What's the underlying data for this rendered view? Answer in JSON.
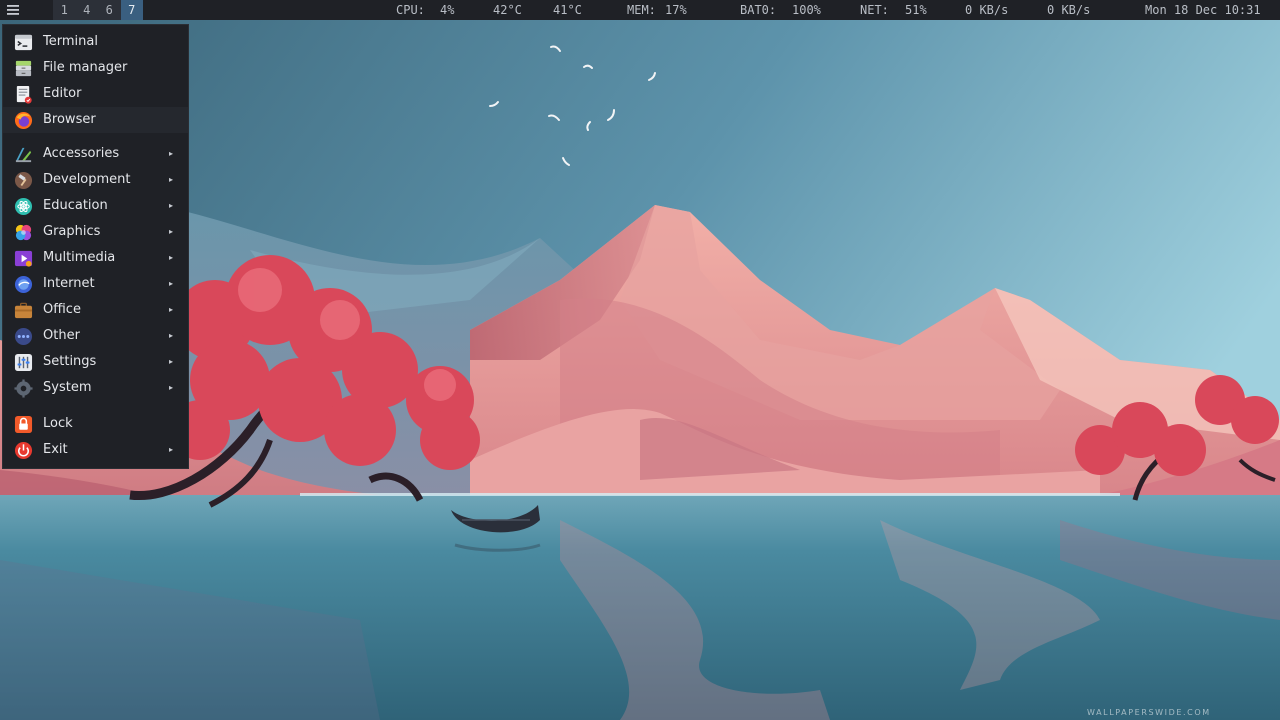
{
  "topbar": {
    "workspaces": [
      "1",
      "4",
      "6",
      "7"
    ],
    "active_workspace": "7",
    "cpu_label": "CPU:",
    "cpu_value": "4%",
    "temp1": "42°C",
    "temp2": "41°C",
    "mem_label": "MEM:",
    "mem_value": "17%",
    "bat_label": "BAT0:",
    "bat_value": "100%",
    "net_label": "NET:",
    "net_value": "51%",
    "net_down": "0 KB/s",
    "net_up": "0 KB/s",
    "clock": "Mon 18 Dec 10:31"
  },
  "menu": {
    "items": [
      {
        "label": "Terminal",
        "icon": "terminal-icon"
      },
      {
        "label": "File manager",
        "icon": "file-manager-icon"
      },
      {
        "label": "Editor",
        "icon": "text-editor-icon"
      },
      {
        "label": "Browser",
        "icon": "firefox-icon"
      }
    ],
    "categories": [
      {
        "label": "Accessories",
        "icon": "accessories-icon"
      },
      {
        "label": "Development",
        "icon": "development-hammer-icon"
      },
      {
        "label": "Education",
        "icon": "education-atom-icon"
      },
      {
        "label": "Graphics",
        "icon": "graphics-palette-icon"
      },
      {
        "label": "Multimedia",
        "icon": "multimedia-play-icon"
      },
      {
        "label": "Internet",
        "icon": "internet-globe-icon"
      },
      {
        "label": "Office",
        "icon": "office-briefcase-icon"
      },
      {
        "label": "Other",
        "icon": "other-dots-icon"
      },
      {
        "label": "Settings",
        "icon": "settings-sliders-icon"
      },
      {
        "label": "System",
        "icon": "system-gear-icon"
      }
    ],
    "session": [
      {
        "label": "Lock",
        "icon": "lock-icon"
      },
      {
        "label": "Exit",
        "icon": "power-icon"
      }
    ],
    "submenu_arrow": "▸"
  },
  "watermark": "WALLPAPERSWIDE.COM",
  "colors": {
    "bar_bg": "#1f2126",
    "active_workspace": "#3a5f80",
    "menu_bg": "#1f2126",
    "sky_top": "#3f6f84",
    "sky_right": "#8cc1d3",
    "mountain_pink": "#e89a98",
    "tree_red": "#d9485a",
    "water": "#3f7a92"
  }
}
